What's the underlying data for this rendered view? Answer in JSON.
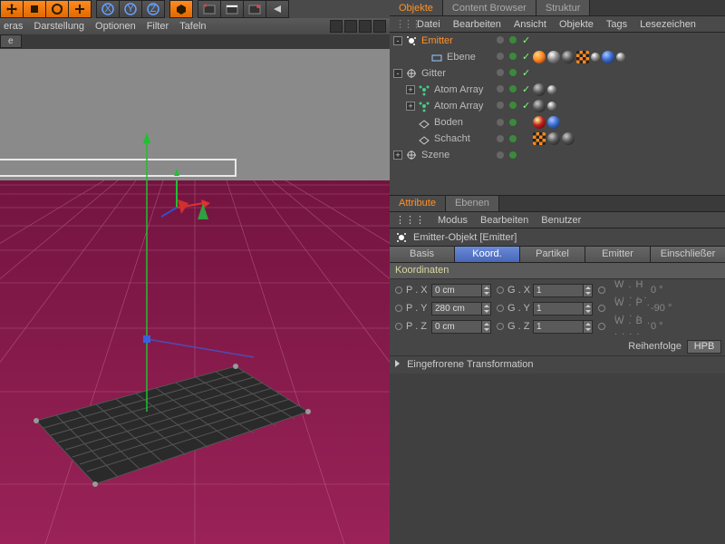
{
  "toolbar_icons": [
    "move",
    "scale",
    "rotate",
    "add",
    "axis-x",
    "axis-y",
    "axis-z",
    "cube",
    "clapper1",
    "clapper2",
    "clapper3",
    "clapper4"
  ],
  "viewport_menu": [
    "eras",
    "Darstellung",
    "Optionen",
    "Filter",
    "Tafeln"
  ],
  "viewport_tab": "e",
  "om": {
    "tabs": [
      "Objekte",
      "Content Browser",
      "Struktur"
    ],
    "active_tab": 0,
    "menu": [
      "Datei",
      "Bearbeiten",
      "Ansicht",
      "Objekte",
      "Tags",
      "Lesezeichen"
    ],
    "tree": [
      {
        "label": "Emitter",
        "icon": "emitter",
        "sel": true,
        "exp": "-",
        "indent": 0,
        "dots": true,
        "chk": true,
        "tags": []
      },
      {
        "label": "Ebene",
        "icon": "plane",
        "sel": false,
        "exp": "",
        "indent": 2,
        "dots": true,
        "chk": true,
        "tags": [
          "or",
          "wh",
          "dk",
          "ck",
          "sm",
          "bl",
          "sm"
        ]
      },
      {
        "label": "Gitter",
        "icon": "null",
        "sel": false,
        "exp": "-",
        "indent": 0,
        "dots": true,
        "chk": true,
        "tags": []
      },
      {
        "label": "Atom Array",
        "icon": "atom",
        "sel": false,
        "exp": "+",
        "indent": 1,
        "dots": true,
        "chk": true,
        "tags": [
          "dk",
          "sm"
        ]
      },
      {
        "label": "Atom Array",
        "icon": "atom",
        "sel": false,
        "exp": "+",
        "indent": 1,
        "dots": true,
        "chk": true,
        "tags": [
          "dk",
          "sm"
        ]
      },
      {
        "label": "Boden",
        "icon": "floor",
        "sel": false,
        "exp": "",
        "indent": 1,
        "dots": true,
        "chk": false,
        "tags": [
          "rd",
          "bl"
        ]
      },
      {
        "label": "Schacht",
        "icon": "floor",
        "sel": false,
        "exp": "",
        "indent": 1,
        "dots": true,
        "chk": false,
        "tags": [
          "ck",
          "dk",
          "dk"
        ]
      },
      {
        "label": "Szene",
        "icon": "null",
        "sel": false,
        "exp": "+",
        "indent": 0,
        "dots": true,
        "chk": false,
        "tags": []
      }
    ]
  },
  "attr": {
    "tabs": [
      "Attribute",
      "Ebenen"
    ],
    "active_tab": 0,
    "menu": [
      "Modus",
      "Bearbeiten",
      "Benutzer"
    ],
    "title": "Emitter-Objekt [Emitter]",
    "subtabs": [
      "Basis",
      "Koord.",
      "Partikel",
      "Emitter",
      "Einschließer"
    ],
    "active_subtab": 1,
    "group": "Koordinaten",
    "rows": [
      {
        "p": "P . X",
        "pv": "0 cm",
        "g": "G . X",
        "gv": "1",
        "w": "W . H",
        "wv": "0 °"
      },
      {
        "p": "P . Y",
        "pv": "280 cm",
        "g": "G . Y",
        "gv": "1",
        "w": "W . P",
        "wv": "-90 °"
      },
      {
        "p": "P . Z",
        "pv": "0 cm",
        "g": "G . Z",
        "gv": "1",
        "w": "W . B",
        "wv": "0 °"
      }
    ],
    "order_label": "Reihenfolge",
    "order_value": "HPB",
    "frozen": "Eingefrorene Transformation"
  }
}
